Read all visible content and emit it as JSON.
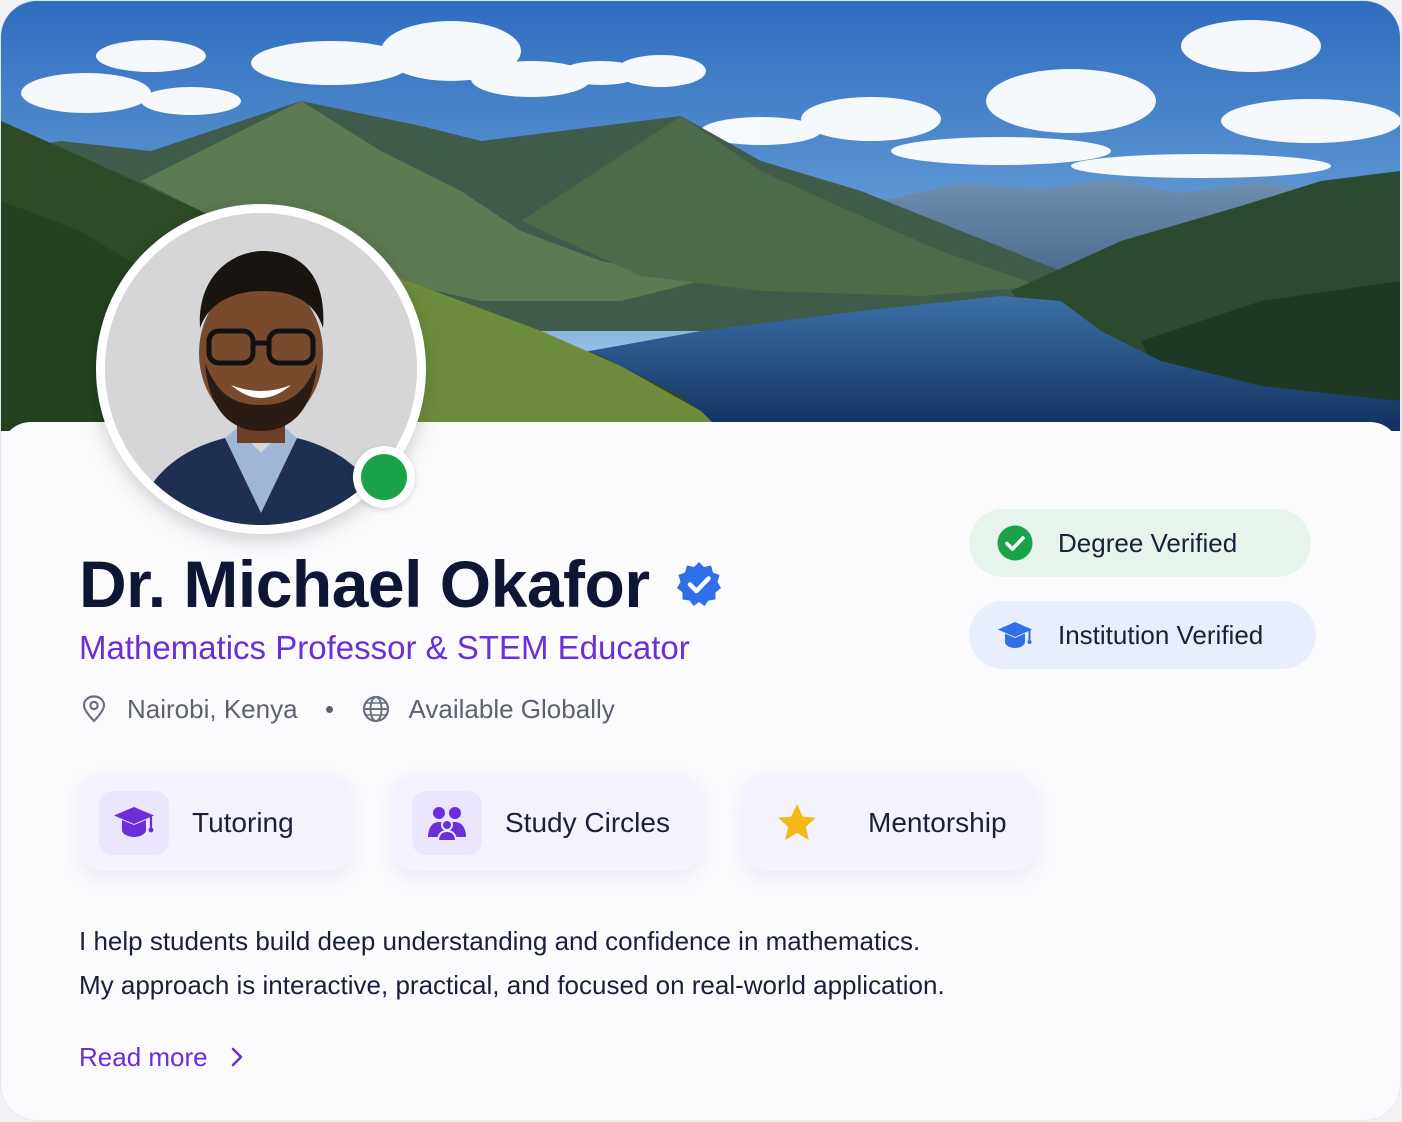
{
  "profile": {
    "name": "Dr. Michael Okafor",
    "role": "Mathematics Professor & STEM Educator",
    "location": "Nairobi, Kenya",
    "availability": "Available Globally",
    "status": "online",
    "verified": true
  },
  "verifications": {
    "degree_label": "Degree Verified",
    "institution_label": "Institution Verified"
  },
  "services": [
    {
      "label": "Tutoring",
      "icon": "graduation-cap-icon"
    },
    {
      "label": "Study Circles",
      "icon": "group-icon"
    },
    {
      "label": "Mentorship",
      "icon": "star-icon"
    }
  ],
  "bio": {
    "line1": "I help students build deep understanding and confidence in mathematics.",
    "line2": "My approach is interactive, practical, and focused on real-world application."
  },
  "read_more_label": "Read more",
  "colors": {
    "accent": "#6a2fd9",
    "verified_blue": "#2f6fe8",
    "online_green": "#1aa24a",
    "degree_badge_bg": "#e6f4ec",
    "institution_badge_bg": "#e9eefc"
  }
}
